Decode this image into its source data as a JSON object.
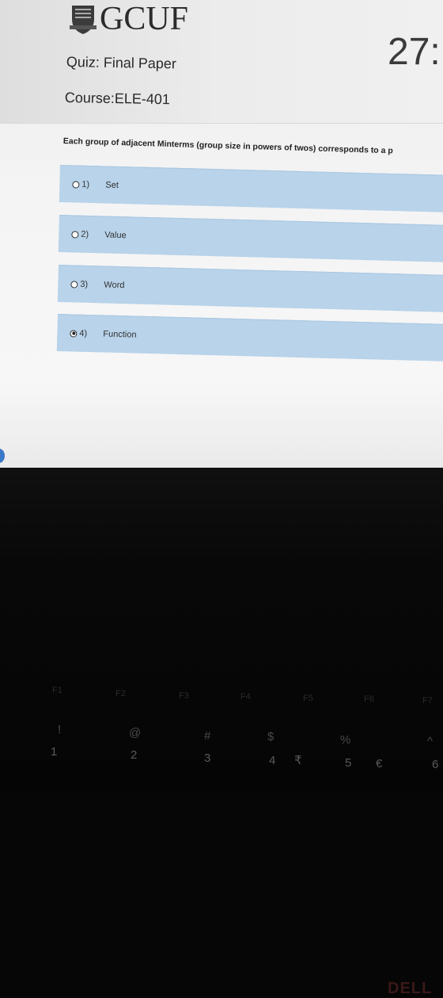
{
  "header": {
    "logo_text": "GCUF",
    "timer": "27:",
    "quiz_title": "Quiz: Final Paper",
    "course": "Course:ELE-401"
  },
  "question": {
    "text": "Each group of adjacent Minterms (group size in powers of twos) corresponds to a p",
    "options": [
      {
        "number": "1)",
        "label": "Set",
        "selected": false
      },
      {
        "number": "2)",
        "label": "Value",
        "selected": false
      },
      {
        "number": "3)",
        "label": "Word",
        "selected": false
      },
      {
        "number": "4)",
        "label": "Function",
        "selected": true
      }
    ]
  },
  "laptop": {
    "brand": "DELL",
    "function_keys": [
      "F1",
      "F2",
      "F3",
      "F4",
      "F5",
      "F6",
      "F7"
    ],
    "symbol_keys": [
      "!",
      "@",
      "#",
      "$",
      "%",
      "^"
    ],
    "digit_keys": [
      "1",
      "2",
      "3",
      "4",
      "5",
      "6"
    ],
    "currency_glyphs": [
      "₹",
      "€"
    ]
  },
  "colors": {
    "option_bg": "#b8d3ea",
    "screen_bg": "#f4f4f4",
    "bezel": "#060606"
  }
}
